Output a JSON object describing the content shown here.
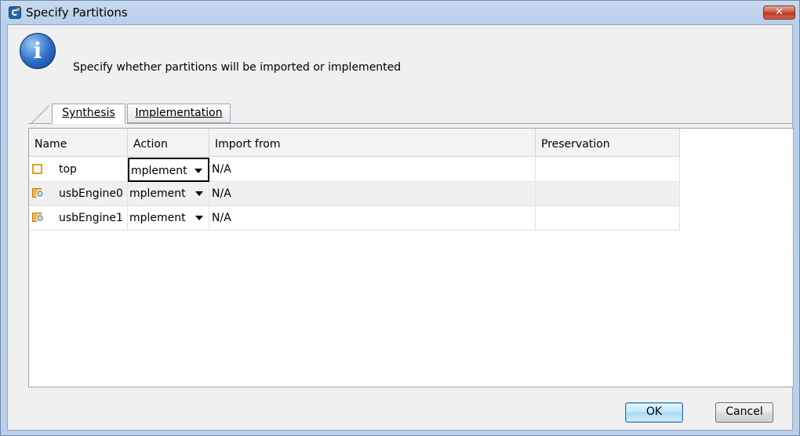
{
  "window": {
    "title": "Specify Partitions",
    "close_label": "✕"
  },
  "message": "Specify whether partitions will be imported or implemented",
  "tabs": [
    {
      "label": "Synthesis",
      "active": true
    },
    {
      "label": "Implementation",
      "active": false
    }
  ],
  "table": {
    "headers": [
      "Name",
      "Action",
      "Import from",
      "Preservation"
    ],
    "rows": [
      {
        "name": "top",
        "icon": "partition-icon",
        "action": "mplement",
        "import_from": "N/A",
        "preservation": ""
      },
      {
        "name": "usbEngine0",
        "icon": "submodule-icon",
        "action": "mplement",
        "import_from": "N/A",
        "preservation": ""
      },
      {
        "name": "usbEngine1",
        "icon": "submodule-icon",
        "action": "mplement",
        "import_from": "N/A",
        "preservation": ""
      }
    ]
  },
  "buttons": {
    "ok": "OK",
    "cancel": "Cancel"
  },
  "colors": {
    "title_bar": "#c9d9ee",
    "ok_border": "#3c7fb1",
    "partition_icon": "#e3a11d"
  }
}
